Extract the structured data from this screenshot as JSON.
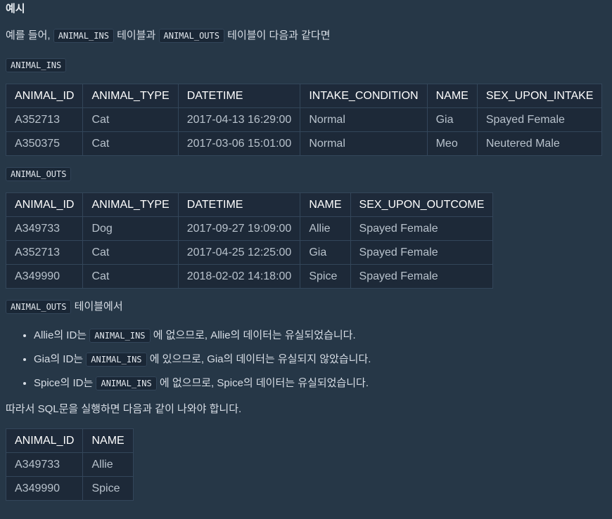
{
  "heading": "예시",
  "intro": {
    "pre": "예를 들어, ",
    "code1": "ANIMAL_INS",
    "mid": " 테이블과 ",
    "code2": "ANIMAL_OUTS",
    "post": " 테이블이 다음과 같다면"
  },
  "ins_label": "ANIMAL_INS",
  "ins_table": {
    "headers": [
      "ANIMAL_ID",
      "ANIMAL_TYPE",
      "DATETIME",
      "INTAKE_CONDITION",
      "NAME",
      "SEX_UPON_INTAKE"
    ],
    "rows": [
      [
        "A352713",
        "Cat",
        "2017-04-13 16:29:00",
        "Normal",
        "Gia",
        "Spayed Female"
      ],
      [
        "A350375",
        "Cat",
        "2017-03-06 15:01:00",
        "Normal",
        "Meo",
        "Neutered Male"
      ]
    ]
  },
  "outs_label": "ANIMAL_OUTS",
  "outs_table": {
    "headers": [
      "ANIMAL_ID",
      "ANIMAL_TYPE",
      "DATETIME",
      "NAME",
      "SEX_UPON_OUTCOME"
    ],
    "rows": [
      [
        "A349733",
        "Dog",
        "2017-09-27 19:09:00",
        "Allie",
        "Spayed Female"
      ],
      [
        "A352713",
        "Cat",
        "2017-04-25 12:25:00",
        "Gia",
        "Spayed Female"
      ],
      [
        "A349990",
        "Cat",
        "2018-02-02 14:18:00",
        "Spice",
        "Spayed Female"
      ]
    ]
  },
  "from_line": {
    "code": "ANIMAL_OUTS",
    "text": " 테이블에서"
  },
  "bullets": [
    {
      "pre": "Allie의 ID는 ",
      "code": "ANIMAL_INS",
      "post": " 에 없으므로, Allie의 데이터는 유실되었습니다."
    },
    {
      "pre": "Gia의 ID는 ",
      "code": "ANIMAL_INS",
      "post": " 에 있으므로, Gia의 데이터는 유실되지 않았습니다."
    },
    {
      "pre": "Spice의 ID는 ",
      "code": "ANIMAL_INS",
      "post": " 에 없으므로, Spice의 데이터는 유실되었습니다."
    }
  ],
  "result_text": "따라서 SQL문을 실행하면 다음과 같이 나와야 합니다.",
  "result_table": {
    "headers": [
      "ANIMAL_ID",
      "NAME"
    ],
    "rows": [
      [
        "A349733",
        "Allie"
      ],
      [
        "A349990",
        "Spice"
      ]
    ]
  }
}
